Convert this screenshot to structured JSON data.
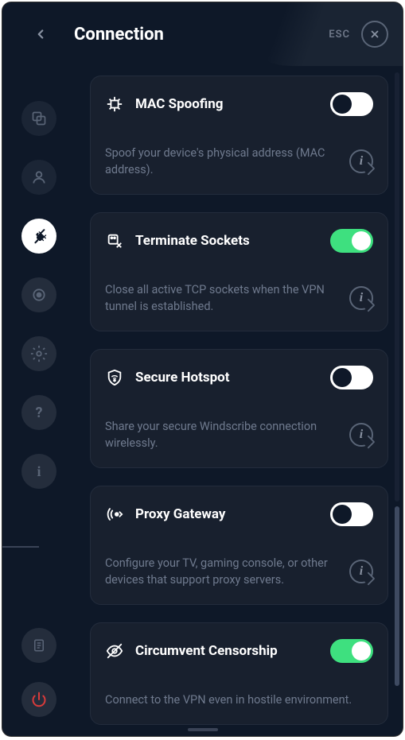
{
  "header": {
    "title": "Connection",
    "esc_label": "ESC"
  },
  "sidebar": {
    "items": [
      {
        "id": "general",
        "icon": "overlap"
      },
      {
        "id": "account",
        "icon": "person"
      },
      {
        "id": "connection",
        "icon": "plug",
        "active": true
      },
      {
        "id": "robert",
        "icon": "target"
      },
      {
        "id": "advanced",
        "icon": "gear"
      },
      {
        "id": "help",
        "icon": "question"
      },
      {
        "id": "about",
        "icon": "info"
      }
    ],
    "bottom": [
      {
        "id": "logs",
        "icon": "doc"
      },
      {
        "id": "quit",
        "icon": "power",
        "color": "#d93b3b"
      }
    ]
  },
  "cards": [
    {
      "id": "mac-spoofing",
      "title": "MAC Spoofing",
      "desc": "Spoof your device's physical address (MAC address).",
      "on": false,
      "icon": "chip",
      "info": true
    },
    {
      "id": "terminate-sockets",
      "title": "Terminate Sockets",
      "desc": "Close all active TCP sockets when the VPN tunnel is established.",
      "on": true,
      "icon": "socket-x",
      "info": true
    },
    {
      "id": "secure-hotspot",
      "title": "Secure Hotspot",
      "desc": "Share your secure Windscribe connection wirelessly.",
      "on": false,
      "icon": "shield-wifi",
      "info": true
    },
    {
      "id": "proxy-gateway",
      "title": "Proxy Gateway",
      "desc": "Configure your TV, gaming console, or other devices that support proxy servers.",
      "on": false,
      "icon": "broadcast",
      "info": true
    },
    {
      "id": "circumvent-censorship",
      "title": "Circumvent Censorship",
      "desc": "Connect to the VPN even in hostile environment.",
      "on": true,
      "icon": "eye-slash",
      "info": false
    }
  ]
}
